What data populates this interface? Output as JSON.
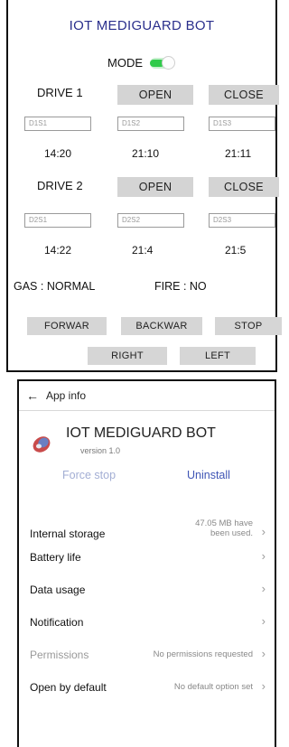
{
  "iot": {
    "title": "IOT MEDIGUARD BOT",
    "mode_label": "MODE",
    "mode_on": true,
    "drive1": {
      "label": "DRIVE 1",
      "open": "OPEN",
      "close": "CLOSE",
      "slots": [
        "D1S1",
        "D1S2",
        "D1S3"
      ],
      "times": [
        "14:20",
        "21:10",
        "21:11"
      ]
    },
    "drive2": {
      "label": "DRIVE 2",
      "open": "OPEN",
      "close": "CLOSE",
      "slots": [
        "D2S1",
        "D2S2",
        "D2S3"
      ],
      "times": [
        "14:22",
        "21:4",
        "21:5"
      ]
    },
    "gas_status": "GAS : NORMAL",
    "fire_status": "FIRE : NO",
    "controls": {
      "forward": "FORWAR",
      "backward": "BACKWAR",
      "stop": "STOP",
      "right": "RIGHT",
      "left": "LEFT"
    },
    "colors": {
      "title": "#2a2f8c",
      "toggle_on": "#2fcb4a",
      "button_bg": "#d4d4d4"
    }
  },
  "app_info": {
    "header_title": "App info",
    "back_icon": "arrow-left-icon",
    "app_name": "IOT MEDIGUARD BOT",
    "version": "version 1.0",
    "force_stop": "Force stop",
    "uninstall": "Uninstall",
    "settings": [
      {
        "label": "Internal storage",
        "value": "47.05 MB have been used.",
        "enabled": true
      },
      {
        "label": "Battery life",
        "value": "",
        "enabled": true
      },
      {
        "label": "Data usage",
        "value": "",
        "enabled": true
      },
      {
        "label": "Notification",
        "value": "",
        "enabled": true
      },
      {
        "label": "Permissions",
        "value": "No permissions requested",
        "enabled": false
      },
      {
        "label": "Open by default",
        "value": "No default option set",
        "enabled": true
      }
    ],
    "colors": {
      "uninstall": "#3f55b5",
      "force_stop_disabled": "#a3aed4"
    }
  }
}
